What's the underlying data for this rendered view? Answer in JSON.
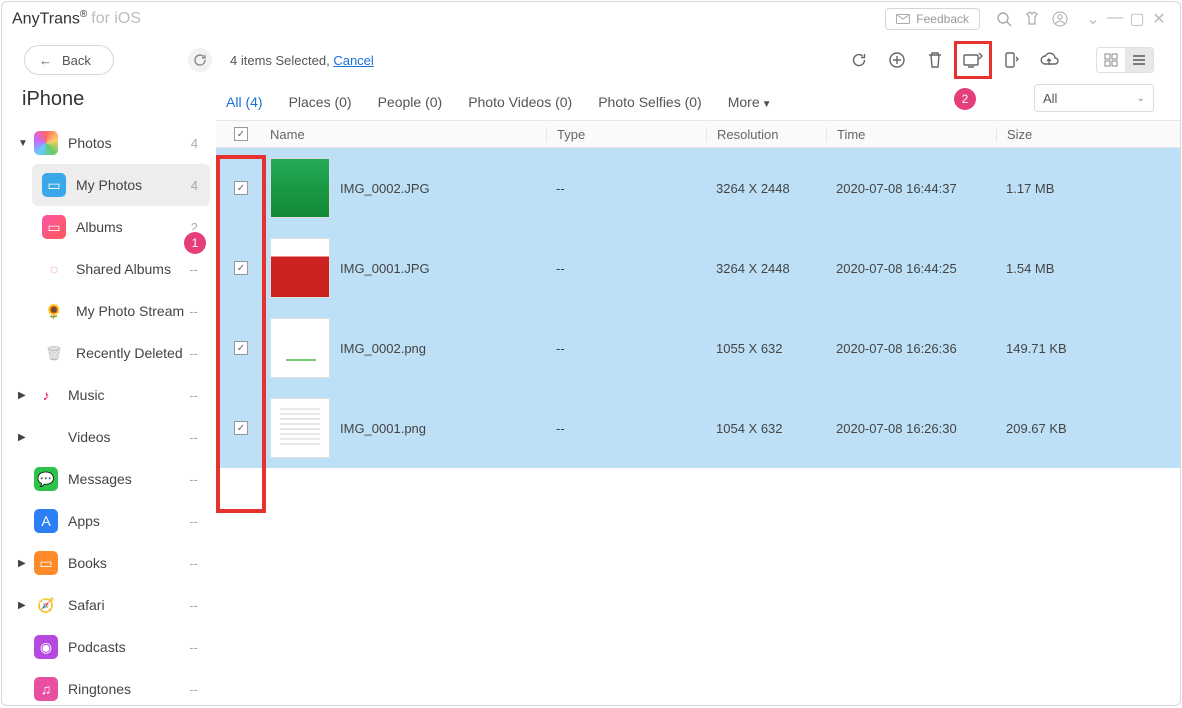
{
  "titlebar": {
    "brand": "AnyTrans",
    "reg": "®",
    "sub": "for iOS",
    "feedback": "Feedback"
  },
  "back_label": "Back",
  "selection": {
    "prefix": "4 items Selected, ",
    "cancel": "Cancel"
  },
  "device": "iPhone",
  "badge1": "1",
  "badge2": "2",
  "sidebar": {
    "photos": {
      "label": "Photos",
      "count": "4"
    },
    "myphotos": {
      "label": "My Photos",
      "count": "4"
    },
    "albums": {
      "label": "Albums",
      "count": "2"
    },
    "shared": {
      "label": "Shared Albums",
      "count": "--"
    },
    "stream": {
      "label": "My Photo Stream",
      "count": "--"
    },
    "deleted": {
      "label": "Recently Deleted",
      "count": "--"
    },
    "music": {
      "label": "Music",
      "count": "--"
    },
    "videos": {
      "label": "Videos",
      "count": "--"
    },
    "messages": {
      "label": "Messages",
      "count": "--"
    },
    "apps": {
      "label": "Apps",
      "count": "--"
    },
    "books": {
      "label": "Books",
      "count": "--"
    },
    "safari": {
      "label": "Safari",
      "count": "--"
    },
    "podcasts": {
      "label": "Podcasts",
      "count": "--"
    },
    "ringtones": {
      "label": "Ringtones",
      "count": "--"
    }
  },
  "tabs": {
    "all": "All (4)",
    "places": "Places (0)",
    "people": "People (0)",
    "videos": "Photo Videos (0)",
    "selfies": "Photo Selfies (0)",
    "more": "More"
  },
  "filter": {
    "value": "All"
  },
  "columns": {
    "name": "Name",
    "type": "Type",
    "res": "Resolution",
    "time": "Time",
    "size": "Size"
  },
  "rows": [
    {
      "name": "IMG_0002.JPG",
      "type": "--",
      "res": "3264 X 2448",
      "time": "2020-07-08 16:44:37",
      "size": "1.17 MB",
      "thumb": "plant"
    },
    {
      "name": "IMG_0001.JPG",
      "type": "--",
      "res": "3264 X 2448",
      "time": "2020-07-08 16:44:25",
      "size": "1.54 MB",
      "thumb": "red"
    },
    {
      "name": "IMG_0002.png",
      "type": "--",
      "res": "1055 X 632",
      "time": "2020-07-08 16:26:36",
      "size": "149.71 KB",
      "thumb": "chart"
    },
    {
      "name": "IMG_0001.png",
      "type": "--",
      "res": "1054 X 632",
      "time": "2020-07-08 16:26:30",
      "size": "209.67 KB",
      "thumb": "doc"
    }
  ]
}
